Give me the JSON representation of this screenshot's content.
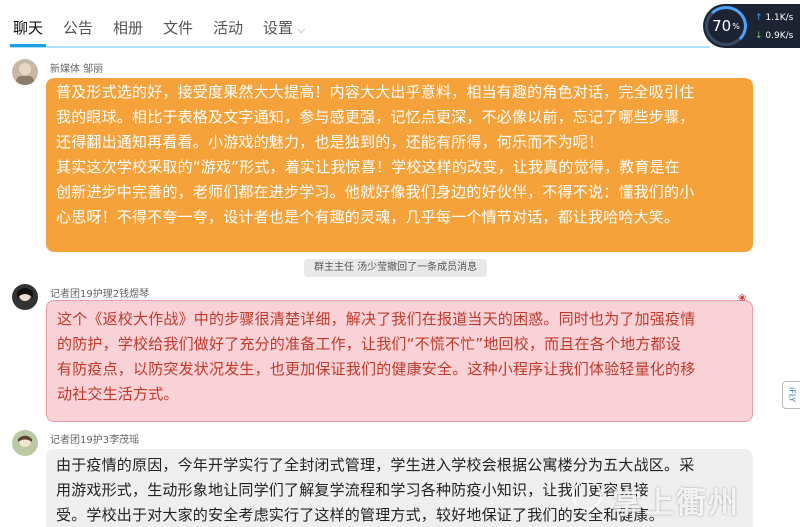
{
  "tabs": [
    {
      "label": "聊天",
      "active": true
    },
    {
      "label": "公告"
    },
    {
      "label": "相册"
    },
    {
      "label": "文件"
    },
    {
      "label": "活动"
    },
    {
      "label": "设置"
    }
  ],
  "speed_widget": {
    "percent": "70",
    "percent_unit": "%",
    "up": "1.1K/s",
    "down": "0.9K/s"
  },
  "messages": [
    {
      "sender": "新媒体 邹丽",
      "lines": [
        "普及形式选的好，接受度果然大大提高！内容大大出乎意料，相当有趣的角色对话，完全吸引住",
        "我的眼球。相比于表格及文字通知，参与感更强，记忆点更深，不必像以前，忘记了哪些步骤，",
        "还得翻出通知再看看。小游戏的魅力，也是独到的，还能有所得，何乐而不为呢！",
        "其实这次学校采取的“游戏”形式，着实让我惊喜！学校这样的改变，让我真的觉得，教育是在",
        "创新进步中完善的，老师们都在进步学习。他就好像我们身边的好伙伴，不得不说：懂我们的小",
        "心思呀！不得不夸一夸，设计者也是个有趣的灵魂，几乎每一个情节对话，都让我哈哈大笑。"
      ],
      "color": "#f5a23a"
    },
    {
      "sender": "记者团19护理2钱煜琴",
      "lines": [
        "这个《返校大作战》中的步骤很清楚详细，解决了我们在报道当天的困惑。同时也为了加强疫情",
        "的防护，学校给我们做好了充分的准备工作，让我们“不慌不忙”地回校，而且在各个地方都设",
        "有防疫点，以防突发状况发生，也更加保证我们的健康安全。这种小程序让我们体验轻量化的移",
        "动社交生活方式。"
      ],
      "color": "#c0392b"
    },
    {
      "sender": "记者团19护3李茂瑶",
      "lines": [
        "由于疫情的原因，今年开学实行了全封闭式管理，学生进入学校会根据公寓楼分为五大战区。采",
        "用游戏形式，生动形象地让同学们了解复学流程和学习各种防疫小知识，让我们更容易接",
        "受。学校出于对大家的安全考虑实行了这样的管理方式，较好地保证了我们的安全和健康。"
      ],
      "color": "#222222"
    }
  ],
  "system_note": "群主主任 汤少莹撤回了一条成员消息",
  "side_tag": "iFLY",
  "watermark": "掌上衢州"
}
